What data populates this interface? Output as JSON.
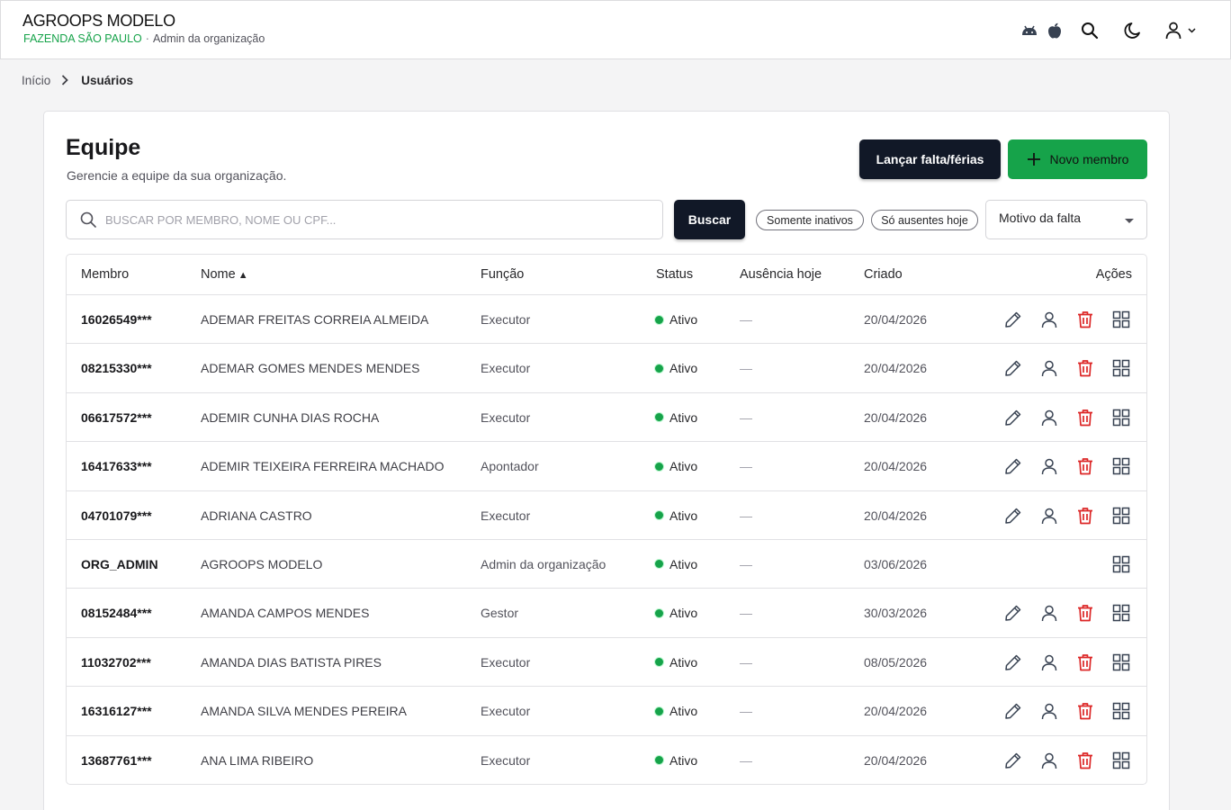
{
  "header": {
    "app_title": "AGROOPS MODELO",
    "org_name": "FAZENDA SÃO PAULO",
    "separator": "·",
    "user_role": "Admin da organização"
  },
  "breadcrumb": {
    "home": "Início",
    "current": "Usuários"
  },
  "page": {
    "title": "Equipe",
    "subtitle": "Gerencie a equipe da sua organização.",
    "absence_button": "Lançar falta/férias",
    "new_member_button": "Novo membro"
  },
  "filters": {
    "search_placeholder": "BUSCAR POR MEMBRO, NOME OU CPF...",
    "search_value": "",
    "search_button": "Buscar",
    "chip_inactive": "Somente inativos",
    "chip_absent": "Só ausentes hoje",
    "reason_select": "Motivo da falta"
  },
  "table": {
    "columns": {
      "member": "Membro",
      "name": "Nome",
      "role": "Função",
      "status": "Status",
      "absence": "Ausência hoje",
      "created": "Criado",
      "actions": "Ações"
    },
    "rows": [
      {
        "member": "16026549***",
        "name": "ADEMAR FREITAS CORREIA ALMEIDA",
        "role": "Executor",
        "status": "Ativo",
        "absence": "—",
        "created": "20/04/2026",
        "full_actions": true
      },
      {
        "member": "08215330***",
        "name": "ADEMAR GOMES MENDES MENDES",
        "role": "Executor",
        "status": "Ativo",
        "absence": "—",
        "created": "20/04/2026",
        "full_actions": true
      },
      {
        "member": "06617572***",
        "name": "ADEMIR CUNHA DIAS ROCHA",
        "role": "Executor",
        "status": "Ativo",
        "absence": "—",
        "created": "20/04/2026",
        "full_actions": true
      },
      {
        "member": "16417633***",
        "name": "ADEMIR TEIXEIRA FERREIRA MACHADO",
        "role": "Apontador",
        "status": "Ativo",
        "absence": "—",
        "created": "20/04/2026",
        "full_actions": true
      },
      {
        "member": "04701079***",
        "name": "ADRIANA CASTRO",
        "role": "Executor",
        "status": "Ativo",
        "absence": "—",
        "created": "20/04/2026",
        "full_actions": true
      },
      {
        "member": "ORG_ADMIN",
        "name": "AGROOPS MODELO",
        "role": "Admin da organização",
        "status": "Ativo",
        "absence": "—",
        "created": "03/06/2026",
        "full_actions": false
      },
      {
        "member": "08152484***",
        "name": "AMANDA CAMPOS MENDES",
        "role": "Gestor",
        "status": "Ativo",
        "absence": "—",
        "created": "30/03/2026",
        "full_actions": true
      },
      {
        "member": "11032702***",
        "name": "AMANDA DIAS BATISTA PIRES",
        "role": "Executor",
        "status": "Ativo",
        "absence": "—",
        "created": "08/05/2026",
        "full_actions": true
      },
      {
        "member": "16316127***",
        "name": "AMANDA SILVA MENDES PEREIRA",
        "role": "Executor",
        "status": "Ativo",
        "absence": "—",
        "created": "20/04/2026",
        "full_actions": true
      },
      {
        "member": "13687761***",
        "name": "ANA LIMA RIBEIRO",
        "role": "Executor",
        "status": "Ativo",
        "absence": "—",
        "created": "20/04/2026",
        "full_actions": true
      }
    ]
  },
  "icons": {
    "header": [
      "android-icon",
      "apple-icon",
      "search-icon",
      "moon-icon",
      "user-icon",
      "chevron-down-icon"
    ],
    "row_actions": [
      "pencil-icon",
      "user-icon",
      "trash-icon",
      "qr-grid-icon"
    ]
  },
  "colors": {
    "accent_green": "#16a34a",
    "dark_button": "#111827",
    "delete_red": "#dc2626"
  }
}
